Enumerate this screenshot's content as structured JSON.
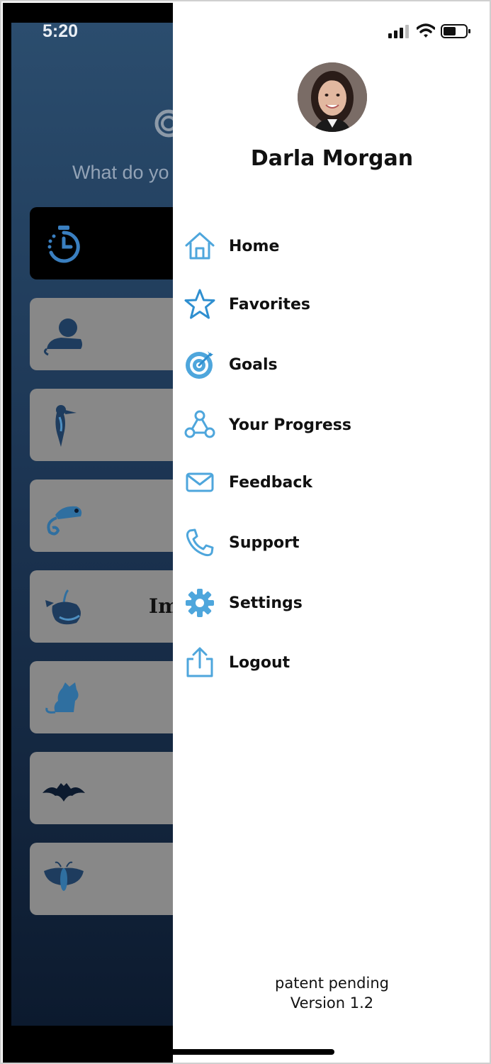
{
  "status_bar": {
    "time": "5:20",
    "icons": [
      "cellular-signal-icon",
      "wifi-icon",
      "battery-icon"
    ]
  },
  "background_app": {
    "prompt": "What do yo",
    "card_text_fragment": "Im",
    "cards": [
      {
        "icon": "timer-icon",
        "active": true
      },
      {
        "icon": "tiger-icon"
      },
      {
        "icon": "woodpecker-icon"
      },
      {
        "icon": "chameleon-icon"
      },
      {
        "icon": "whale-icon"
      },
      {
        "icon": "jaguar-icon"
      },
      {
        "icon": "bat-icon"
      },
      {
        "icon": "moth-icon"
      }
    ]
  },
  "drawer": {
    "user_name": "Darla Morgan",
    "menu": [
      {
        "label": "Home",
        "icon": "home-icon"
      },
      {
        "label": "Favorites",
        "icon": "star-icon"
      },
      {
        "label": "Goals",
        "icon": "target-icon"
      },
      {
        "label": "Your Progress",
        "icon": "progress-nodes-icon"
      },
      {
        "label": "Feedback",
        "icon": "mail-icon"
      },
      {
        "label": "Support",
        "icon": "phone-icon"
      },
      {
        "label": "Settings",
        "icon": "gear-icon"
      },
      {
        "label": "Logout",
        "icon": "share-upload-icon"
      }
    ],
    "footer": {
      "line1": "patent pending",
      "line2": "Version 1.2"
    }
  },
  "colors": {
    "icon_blue": "#4ea6dc",
    "icon_blue_dark": "#2f8fd0",
    "text": "#111111",
    "bg_gradient_top": "#2b4d6e",
    "bg_gradient_bottom": "#0c1a2e",
    "card_gray": "#888888"
  }
}
